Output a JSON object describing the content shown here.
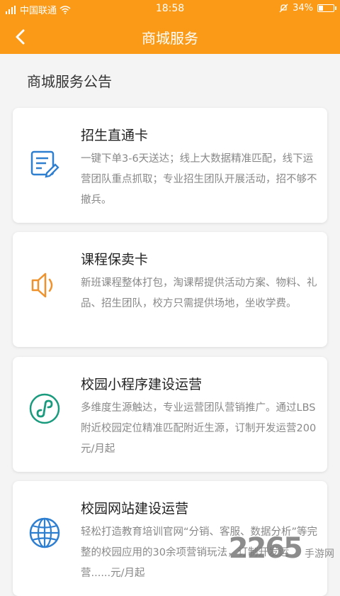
{
  "status": {
    "carrier": "中国联通",
    "time": "18:58",
    "battery": "34%",
    "battery_level": 0.34
  },
  "header": {
    "title": "商城服务"
  },
  "section": {
    "title": "商城服务公告"
  },
  "cards": [
    {
      "title": "招生直通卡",
      "desc": "一键下单3-6天送达；线上大数据精准匹配，线下运营团队重点抓取；专业招生团队开展活动，招不够不撤兵。",
      "icon": "document-edit-icon",
      "color": "#2f7fd1"
    },
    {
      "title": "课程保卖卡",
      "desc": "新班课程整体打包，淘课帮提供活动方案、物料、礼品、招生团队，校方只需提供场地，坐收学费。",
      "icon": "speaker-icon",
      "color": "#f0922b"
    },
    {
      "title": "校园小程序建设运营",
      "desc": "多维度生源触达，专业运营团队营销推广。通过LBS附近校园定位精准匹配附近生源，订制开发运营200元/月起",
      "icon": "mini-program-icon",
      "color": "#1a9b7e"
    },
    {
      "title": "校园网站建设运营",
      "desc": "轻松打造教育培训官网“分销、客服、数据分析”等完整的校园应用的30余项营销玩法，订制开发运营......元/月起",
      "icon": "globe-icon",
      "color": "#2f7fd1"
    }
  ],
  "watermark": {
    "number": "2265",
    "text": "手游网"
  }
}
